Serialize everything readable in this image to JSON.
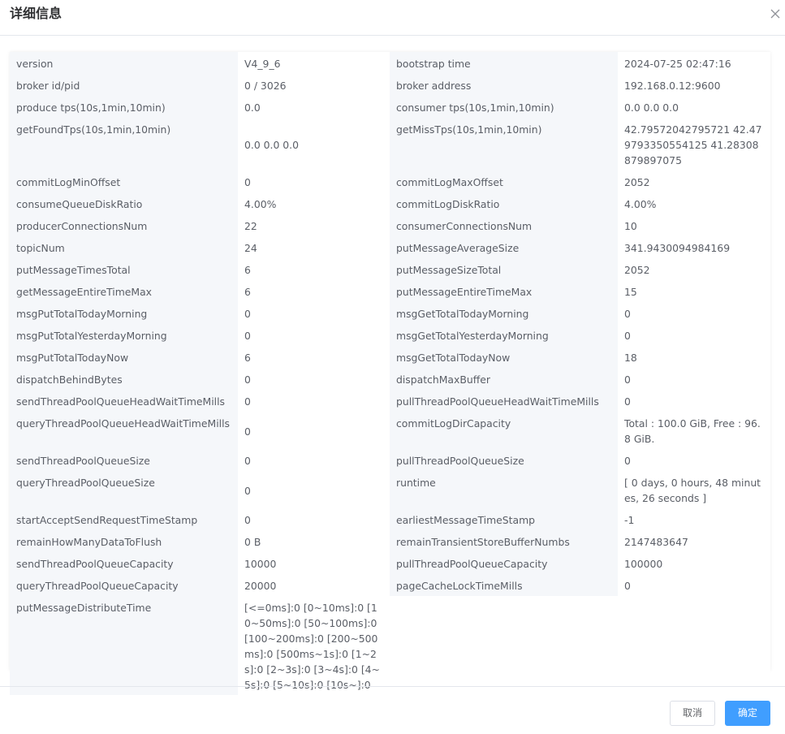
{
  "dialog": {
    "title": "详细信息",
    "close_icon": "close-icon"
  },
  "rows": [
    {
      "k1": "version",
      "v1": "V4_9_6",
      "k2": "bootstrap time",
      "v2": "2024-07-25 02:47:16"
    },
    {
      "k1": "broker id/pid",
      "v1": "0 / 3026",
      "k2": "broker address",
      "v2": "192.168.0.12:9600"
    },
    {
      "k1": "produce tps(10s,1min,10min)",
      "v1": "0.0",
      "k2": "consumer tps(10s,1min,10min)",
      "v2": "0.0 0.0 0.0"
    },
    {
      "k1": "getFoundTps(10s,1min,10min)",
      "v1": "0.0 0.0 0.0",
      "k2": "getMissTps(10s,1min,10min)",
      "v2": "42.79572042795721 42.479793350554125 41.28308879897075"
    },
    {
      "k1": "commitLogMinOffset",
      "v1": "0",
      "k2": "commitLogMaxOffset",
      "v2": "2052"
    },
    {
      "k1": "consumeQueueDiskRatio",
      "v1": "4.00%",
      "k2": "commitLogDiskRatio",
      "v2": "4.00%"
    },
    {
      "k1": "producerConnectionsNum",
      "v1": "22",
      "k2": "consumerConnectionsNum",
      "v2": "10"
    },
    {
      "k1": "topicNum",
      "v1": "24",
      "k2": "putMessageAverageSize",
      "v2": "341.9430094984169"
    },
    {
      "k1": "putMessageTimesTotal",
      "v1": "6",
      "k2": "putMessageSizeTotal",
      "v2": "2052"
    },
    {
      "k1": "getMessageEntireTimeMax",
      "v1": "6",
      "k2": "putMessageEntireTimeMax",
      "v2": "15"
    },
    {
      "k1": "msgPutTotalTodayMorning",
      "v1": "0",
      "k2": "msgGetTotalTodayMorning",
      "v2": "0"
    },
    {
      "k1": "msgPutTotalYesterdayMorning",
      "v1": "0",
      "k2": "msgGetTotalYesterdayMorning",
      "v2": "0"
    },
    {
      "k1": "msgPutTotalTodayNow",
      "v1": "6",
      "k2": "msgGetTotalTodayNow",
      "v2": "18"
    },
    {
      "k1": "dispatchBehindBytes",
      "v1": "0",
      "k2": "dispatchMaxBuffer",
      "v2": "0"
    },
    {
      "k1": "sendThreadPoolQueueHeadWaitTimeMills",
      "v1": "0",
      "k2": "pullThreadPoolQueueHeadWaitTimeMills",
      "v2": "0"
    },
    {
      "k1": "queryThreadPoolQueueHeadWaitTimeMills",
      "v1": "0",
      "k2": "commitLogDirCapacity",
      "v2": "Total : 100.0 GiB, Free : 96.8 GiB."
    },
    {
      "k1": "sendThreadPoolQueueSize",
      "v1": "0",
      "k2": "pullThreadPoolQueueSize",
      "v2": "0"
    },
    {
      "k1": "queryThreadPoolQueueSize",
      "v1": "0",
      "k2": "runtime",
      "v2": "[ 0 days, 0 hours, 48 minutes, 26 seconds ]"
    },
    {
      "k1": "startAcceptSendRequestTimeStamp",
      "v1": "0",
      "k2": "earliestMessageTimeStamp",
      "v2": "-1"
    },
    {
      "k1": "remainHowManyDataToFlush",
      "v1": "0 B",
      "k2": "remainTransientStoreBufferNumbs",
      "v2": "2147483647"
    },
    {
      "k1": "sendThreadPoolQueueCapacity",
      "v1": "10000",
      "k2": "pullThreadPoolQueueCapacity",
      "v2": "100000"
    },
    {
      "k1": "queryThreadPoolQueueCapacity",
      "v1": "20000",
      "k2": "pageCacheLockTimeMills",
      "v2": "0"
    },
    {
      "k1": "putMessageDistributeTime",
      "v1": "[<=0ms]:0 [0~10ms]:0 [10~50ms]:0 [50~100ms]:0 [100~200ms]:0 [200~500ms]:0 [500ms~1s]:0 [1~2s]:0 [2~3s]:0 [3~4s]:0 [4~5s]:0 [5~10s]:0 [10s~]:0",
      "k2": "",
      "v2": ""
    }
  ],
  "footer": {
    "cancel_label": "取消",
    "ok_label": "确定"
  },
  "colors": {
    "primary": "#409eff",
    "label_bg": "#f5f7fa",
    "text": "#606266"
  }
}
